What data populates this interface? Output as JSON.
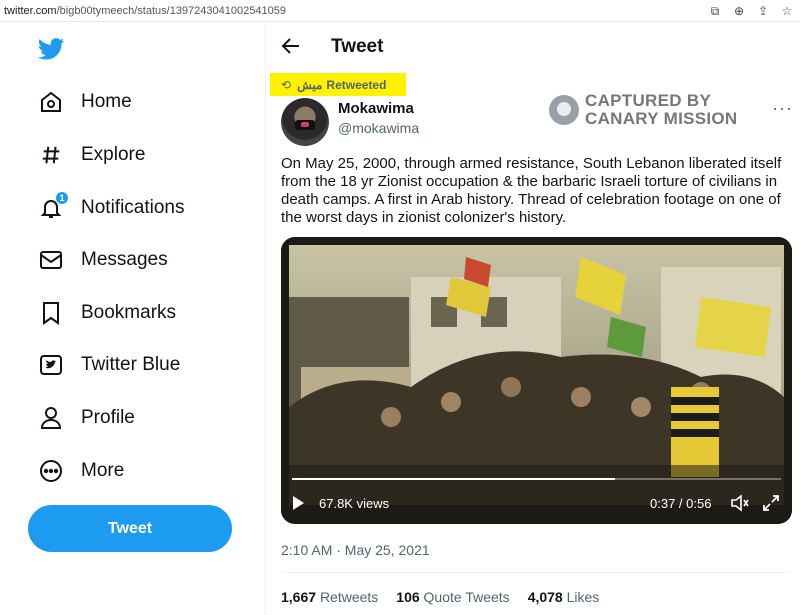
{
  "browser": {
    "url_host": "twitter.com",
    "url_path": "/bigb00tymeech/status/1397243041002541059"
  },
  "sidebar": {
    "items": [
      {
        "label": "Home",
        "icon": "home-icon"
      },
      {
        "label": "Explore",
        "icon": "hashtag-icon"
      },
      {
        "label": "Notifications",
        "icon": "bell-icon",
        "badge": "1"
      },
      {
        "label": "Messages",
        "icon": "envelope-icon"
      },
      {
        "label": "Bookmarks",
        "icon": "bookmark-icon"
      },
      {
        "label": "Twitter Blue",
        "icon": "twitter-blue-icon"
      },
      {
        "label": "Profile",
        "icon": "person-icon"
      },
      {
        "label": "More",
        "icon": "more-circle-icon"
      }
    ],
    "tweet_button": "Tweet"
  },
  "header": {
    "title": "Tweet"
  },
  "retweet": {
    "name": "ميش",
    "word": "Retweeted"
  },
  "author": {
    "name": "Mokawima",
    "handle": "@mokawima"
  },
  "watermark": {
    "line1": "CAPTURED BY",
    "line2": "CANARY MISSION"
  },
  "tweet": {
    "text": "On May 25, 2000, through armed resistance, South Lebanon liberated itself from the 18 yr Zionist occupation & the barbaric Israeli torture of civilians in death camps. A first in Arab history. Thread of celebration footage on one of the worst days in zionist colonizer's history.",
    "timestamp": "2:10 AM · May 25, 2021"
  },
  "video": {
    "views": "67.8K views",
    "time": "0:37 / 0:56",
    "progress": 0.66
  },
  "stats": {
    "retweets_count": "1,667",
    "retweets_label": "Retweets",
    "quotes_count": "106",
    "quotes_label": "Quote Tweets",
    "likes_count": "4,078",
    "likes_label": "Likes"
  },
  "colors": {
    "accent": "#1d9bf0",
    "highlight": "#fff200"
  }
}
